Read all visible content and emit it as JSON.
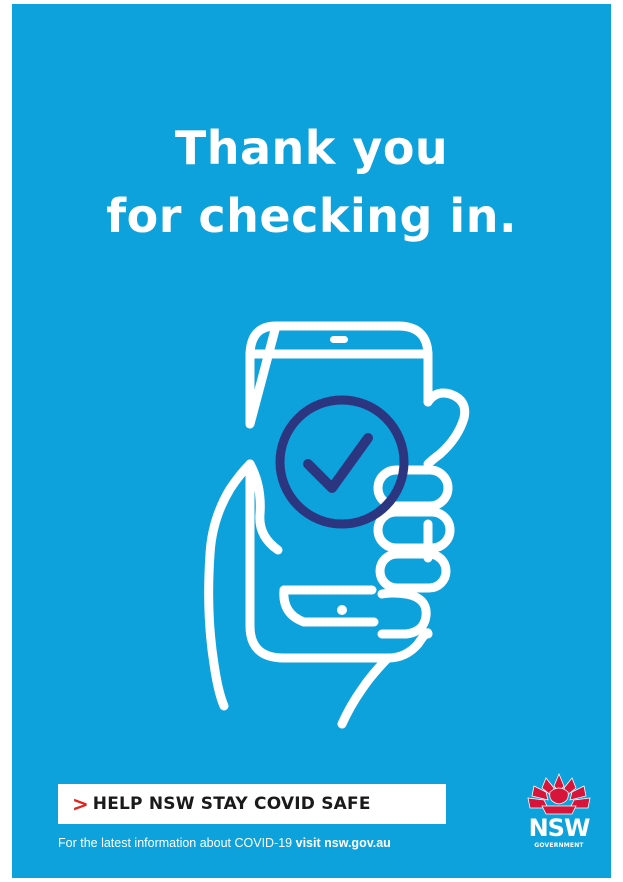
{
  "headline": {
    "line1": "Thank you",
    "line2": "for checking in."
  },
  "illustration": {
    "icon": "hand-holding-phone-check-icon"
  },
  "banner": {
    "chevron": ">",
    "text": "HELP NSW STAY COVID SAFE"
  },
  "info": {
    "prefix": "For the latest information about COVID-19",
    "link": "visit nsw.gov.au"
  },
  "logo": {
    "icon": "waratah-icon",
    "name": "NSW",
    "sub": "GOVERNMENT"
  },
  "colors": {
    "background": "#0da2dc",
    "check_ring": "#2c3580",
    "banner_accent": "#e4211b",
    "logo_red": "#d7153a"
  }
}
